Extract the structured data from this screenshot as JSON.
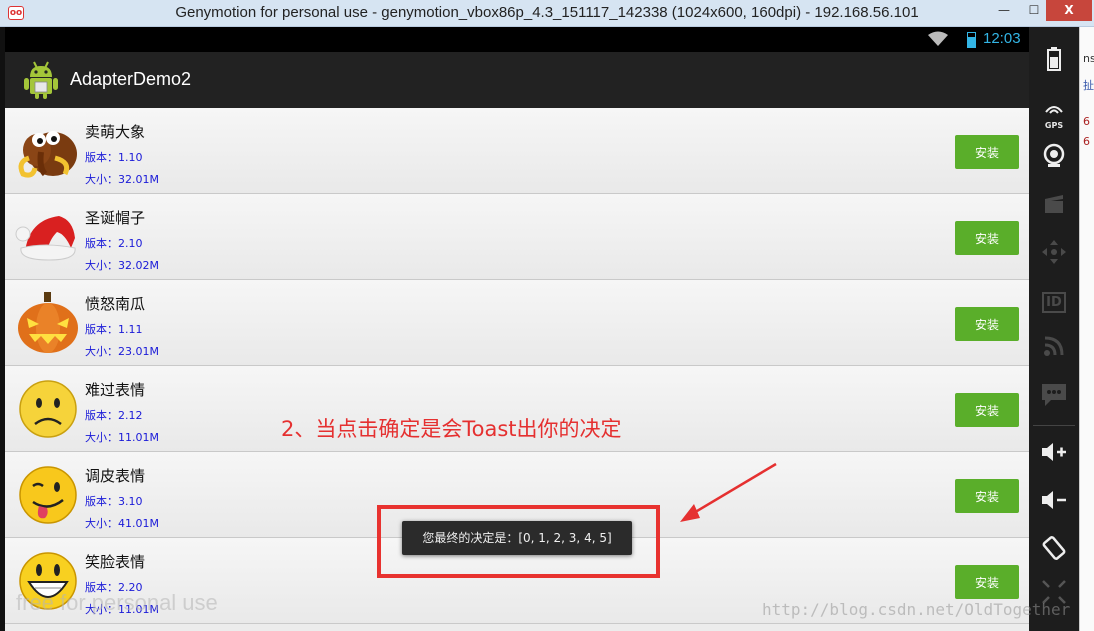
{
  "window": {
    "title": "Genymotion for personal use - genymotion_vbox86p_4.3_151117_142338 (1024x600, 160dpi) - 192.168.56.101",
    "icon": "genymotion-logo-icon",
    "minimize": "—",
    "maximize": "☐",
    "close": "X"
  },
  "statusbar": {
    "time": "12:03"
  },
  "app": {
    "title": "AdapterDemo2",
    "icon": "android-icon"
  },
  "list": {
    "items": [
      {
        "name": "卖萌大象",
        "version": "版本：1.10",
        "size": "大小：32.01M",
        "button": "安装",
        "icon": "mammoth-icon"
      },
      {
        "name": "圣诞帽子",
        "version": "版本：2.10",
        "size": "大小：32.02M",
        "button": "安装",
        "icon": "santa-hat-icon"
      },
      {
        "name": "愤怒南瓜",
        "version": "版本：1.11",
        "size": "大小：23.01M",
        "button": "安装",
        "icon": "pumpkin-icon"
      },
      {
        "name": "难过表情",
        "version": "版本：2.12",
        "size": "大小：11.01M",
        "button": "安装",
        "icon": "sad-face-icon"
      },
      {
        "name": "调皮表情",
        "version": "版本：3.10",
        "size": "大小：41.01M",
        "button": "安装",
        "icon": "tongue-face-icon"
      },
      {
        "name": "笑脸表情",
        "version": "版本：2.20",
        "size": "大小：11.01M",
        "button": "安装",
        "icon": "smile-face-icon"
      }
    ]
  },
  "toast": {
    "text": "您最终的决定是：[0, 1, 2, 3, 4, 5]"
  },
  "annotation": {
    "text": "2、当点击确定是会Toast出你的决定"
  },
  "watermark": {
    "left": "free for personal use",
    "right": "http://blog.csdn.net/OldTogether"
  },
  "sidebar": {
    "gps_label": "GPS",
    "id_label": "ID",
    "items": [
      "battery-icon",
      "gps-icon",
      "camera-icon",
      "video-capture-icon",
      "dpad-icon",
      "device-id-icon",
      "rss-icon",
      "sms-icon",
      "volume-up-icon",
      "volume-down-icon",
      "rotate-icon",
      "scale-icon"
    ]
  },
  "right_strip": {
    "chars": [
      "ns",
      "扯",
      "6",
      "6"
    ]
  },
  "colors": {
    "install_button": "#5aae2a",
    "actionbar": "#222222",
    "accent": "#33b5e5",
    "annotation": "#e53030"
  }
}
